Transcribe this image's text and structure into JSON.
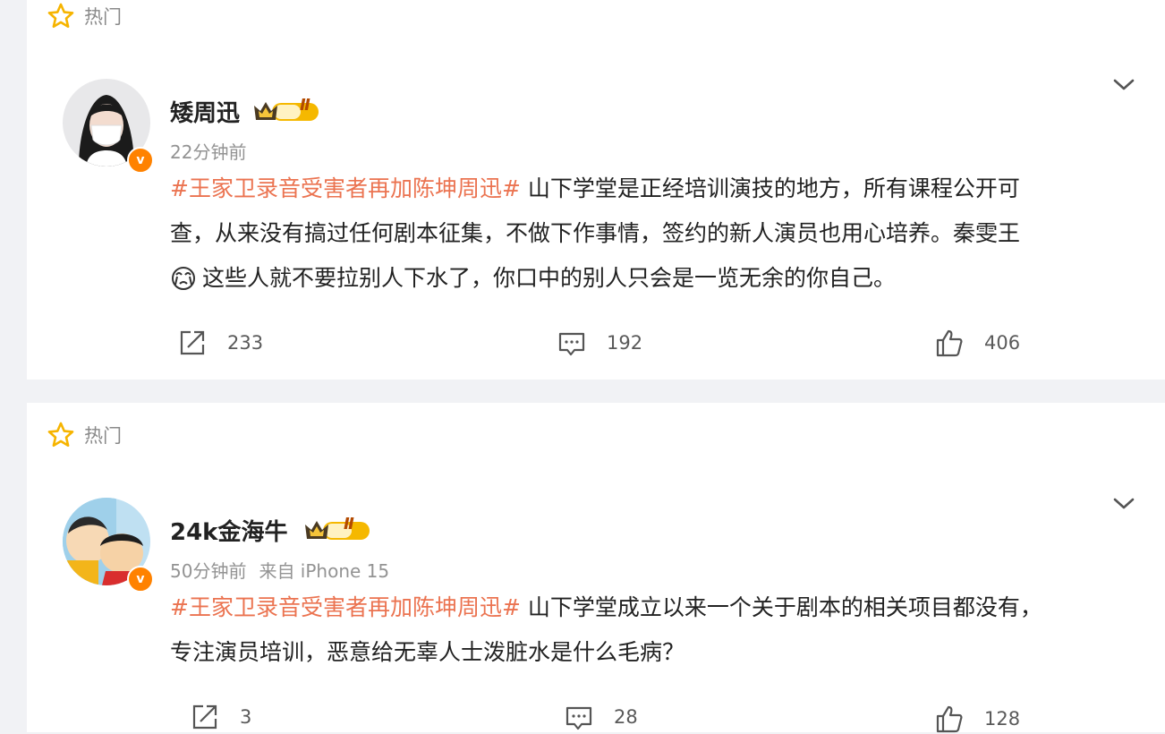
{
  "posts": [
    {
      "hot_label": "热门",
      "username": "矮周迅",
      "level": "Ⅱ",
      "time": "22分钟前",
      "source": "",
      "topic": "#王家卫录音受害者再加陈坤周迅#",
      "text_line1": "山下学堂是正经培训演技的地方，所有课程公开可",
      "text_line2": "查，从来没有搞过任何剧本征集，不做下作事情，签约的新人演员也用心培养。秦雯王",
      "text_line3": "这些人就不要拉别人下水了，你口中的别人只会是一览无余的你自己。",
      "emoji_icon": "crying-face-icon",
      "reposts": "233",
      "comments": "192",
      "likes": "406"
    },
    {
      "hot_label": "热门",
      "username": "24k金海牛",
      "level": "Ⅱ",
      "time": "50分钟前",
      "source": "来自 iPhone 15",
      "topic": "#王家卫录音受害者再加陈坤周迅#",
      "text_line1": "山下学堂成立以来一个关于剧本的相关项目都没有，",
      "text_line2": "专注演员培训，恶意给无辜人士泼脏水是什么毛病？",
      "reposts": "3",
      "comments": "28",
      "likes": "128"
    }
  ],
  "colors": {
    "topic": "#eb7350",
    "badge_gold": "#f5b800",
    "verified": "#ff8200",
    "background": "#f1f2f5"
  }
}
